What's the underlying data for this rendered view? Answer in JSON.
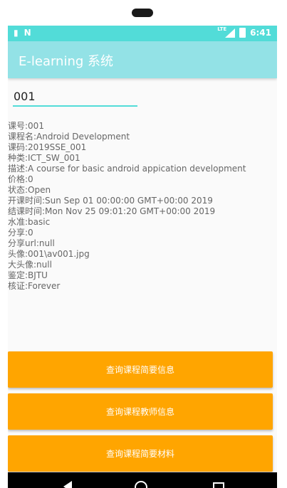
{
  "status_bar": {
    "time": "6:41",
    "network": "LTE"
  },
  "app_bar": {
    "title": "E-learning 系统"
  },
  "search": {
    "value": "001"
  },
  "course_info": [
    "课号:001",
    "课程名:Android Development",
    "课码:2019SSE_001",
    "种类:ICT_SW_001",
    "描述:A course for basic android appication development",
    "价格:0",
    "状态:Open",
    "开课时间:Sun Sep 01 00:00:00 GMT+00:00 2019",
    "结课时间:Mon Nov 25 09:01:20 GMT+00:00 2019",
    "水准:basic",
    "分享:0",
    "分享url:null",
    "头像:001\\av001.jpg",
    "大头像:null",
    "鉴定:BJTU",
    "核证:Forever"
  ],
  "buttons": {
    "summary": "查询课程简要信息",
    "teacher": "查询课程教师信息",
    "materials": "查询课程简要材料"
  },
  "colors": {
    "status_bar": "#52dcd8",
    "app_bar": "#93e2e6",
    "button": "#ffa500",
    "input_underline": "#52dcd8"
  }
}
